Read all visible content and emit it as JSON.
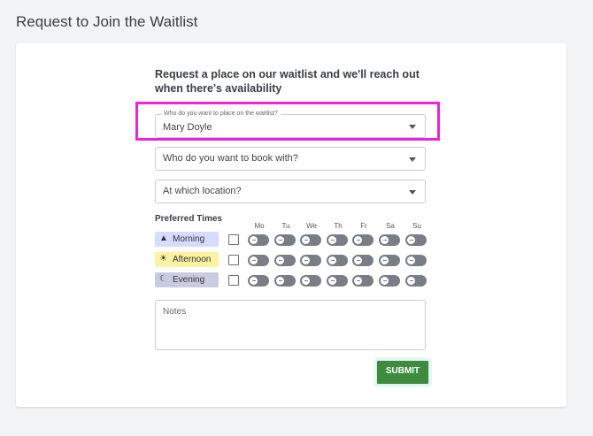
{
  "page": {
    "title": "Request to Join the Waitlist"
  },
  "form": {
    "intro": "Request a place on our waitlist and we'll reach out when there's availability",
    "who_place": {
      "label": "Who do you want to place on the waitlist?",
      "value": "Mary Doyle"
    },
    "who_book": {
      "placeholder": "Who do you want to book with?"
    },
    "location": {
      "placeholder": "At which location?"
    },
    "preferred_times": {
      "label": "Preferred Times",
      "days": [
        "Mo",
        "Tu",
        "We",
        "Th",
        "Fr",
        "Sa",
        "Su"
      ],
      "slots": [
        {
          "label": "Morning",
          "icon": "mountain-icon",
          "color": "#d6dbff"
        },
        {
          "label": "Afternoon",
          "icon": "sun-icon",
          "color": "#fbf3a3"
        },
        {
          "label": "Evening",
          "icon": "moon-icon",
          "color": "#c9cce0"
        }
      ]
    },
    "notes_placeholder": "Notes",
    "submit_label": "SUBMIT"
  },
  "colors": {
    "highlight": "#ee22dd",
    "submit": "#3e8a3e"
  }
}
